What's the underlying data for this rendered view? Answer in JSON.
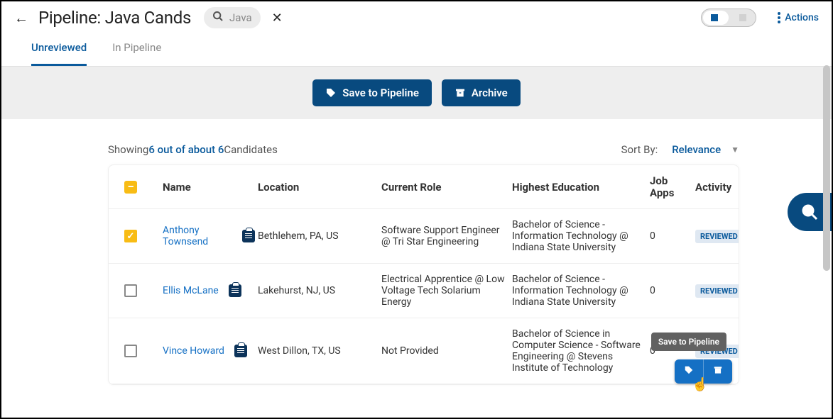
{
  "header": {
    "title": "Pipeline: Java Cands",
    "search_term": "Java",
    "actions_label": "Actions"
  },
  "tabs": {
    "unreviewed": "Unreviewed",
    "in_pipeline": "In Pipeline"
  },
  "action_bar": {
    "save_label": "Save to Pipeline",
    "archive_label": "Archive"
  },
  "results": {
    "prefix": "Showing ",
    "count": "6 out of about 6",
    "suffix": " Candidates",
    "sort_label": "Sort By:",
    "sort_value": "Relevance"
  },
  "columns": {
    "name": "Name",
    "location": "Location",
    "role": "Current Role",
    "education": "Highest Education",
    "apps1": "Job",
    "apps2": "Apps",
    "activity": "Activity"
  },
  "rows": [
    {
      "checked": true,
      "name": "Anthony Townsend",
      "location": "Bethlehem, PA, US",
      "role": "Software Support Engineer @ Tri Star Engineering",
      "education": "Bachelor of Science - Information Technology @ Indiana State University",
      "apps": "0",
      "activity": "REVIEWED"
    },
    {
      "checked": false,
      "name": "Ellis McLane",
      "location": "Lakehurst, NJ, US",
      "role": "Electrical Apprentice @ Low Voltage Tech Solarium Energy",
      "education": "Bachelor of Science - Information Technology @ Indiana State University",
      "apps": "0",
      "activity": "REVIEWED"
    },
    {
      "checked": false,
      "name": "Vince Howard",
      "location": "West Dillon, TX, US",
      "role": "Not Provided",
      "education": "Bachelor of Science in Computer Science - Software Engineering @ Stevens Institute of Technology",
      "apps": "0",
      "activity": "REVIEWED"
    }
  ],
  "tooltip": "Save to Pipeline"
}
